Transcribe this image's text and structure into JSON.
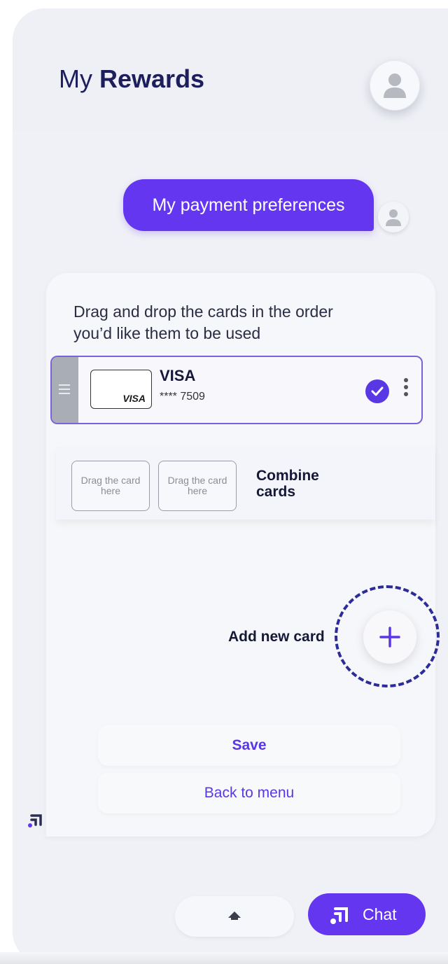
{
  "header": {
    "title_prefix": "My",
    "title_bold": "Rewards"
  },
  "chat": {
    "user_message": "My payment preferences"
  },
  "panel": {
    "instruction": "Drag and drop the cards in the order you’d like them to be used",
    "card": {
      "logo_text": "VISA",
      "name": "VISA",
      "number": "**** 7509",
      "selected": true
    },
    "combine": {
      "slot1": "Drag the card here",
      "slot2": "Drag the card here",
      "label": "Combine cards"
    },
    "add_card_label": "Add new card",
    "save_label": "Save",
    "back_label": "Back to menu"
  },
  "footer": {
    "chat_label": "Chat"
  },
  "colors": {
    "accent": "#6436ef",
    "title": "#1d1f5c",
    "highlight_ring": "#2c2b9a"
  },
  "icons": [
    "user-avatar-icon",
    "drag-handle-icon",
    "check-icon",
    "kebab-menu-icon",
    "plus-icon",
    "chevron-up-icon",
    "chat-logo-icon"
  ]
}
